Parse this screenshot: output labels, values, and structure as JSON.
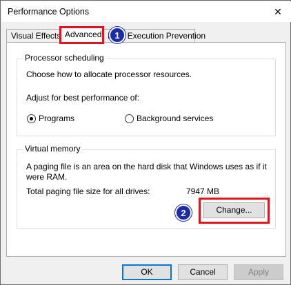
{
  "window": {
    "title": "Performance Options",
    "close_glyph": "✕"
  },
  "tabs": [
    {
      "label": "Visual Effects",
      "active": false
    },
    {
      "label": "Advanced",
      "active": true
    },
    {
      "label": "Data Execution Prevention",
      "active": false
    }
  ],
  "processor": {
    "legend": "Processor scheduling",
    "description": "Choose how to allocate processor resources.",
    "adjust_label": "Adjust for best performance of:",
    "options": [
      {
        "label": "Programs",
        "selected": true
      },
      {
        "label": "Background services",
        "selected": false
      }
    ]
  },
  "virtual_memory": {
    "legend": "Virtual memory",
    "description_line1": "A paging file is an area on the hard disk that Windows uses as if it",
    "description_line2": "were RAM.",
    "total_label": "Total paging file size for all drives:",
    "total_value": "7947 MB",
    "change_button": "Change..."
  },
  "footer": {
    "ok": "OK",
    "cancel": "Cancel",
    "apply": "Apply"
  },
  "annotations": {
    "step1": "1",
    "step2": "2",
    "highlight_color": "#e0141e",
    "badge_color": "#1a2ca8"
  }
}
